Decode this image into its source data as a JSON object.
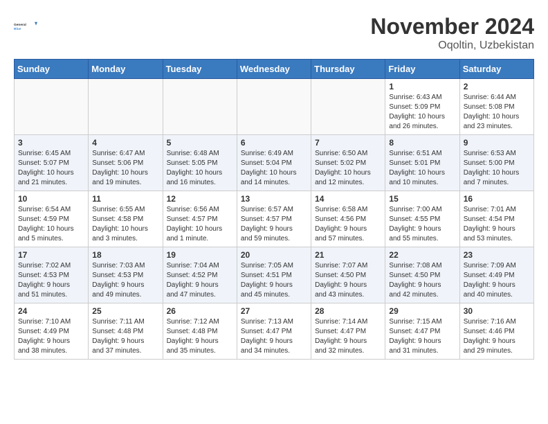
{
  "header": {
    "logo_line1": "General",
    "logo_line2": "Blue",
    "month": "November 2024",
    "location": "Oqoltin, Uzbekistan"
  },
  "weekdays": [
    "Sunday",
    "Monday",
    "Tuesday",
    "Wednesday",
    "Thursday",
    "Friday",
    "Saturday"
  ],
  "weeks": [
    [
      {
        "day": "",
        "info": ""
      },
      {
        "day": "",
        "info": ""
      },
      {
        "day": "",
        "info": ""
      },
      {
        "day": "",
        "info": ""
      },
      {
        "day": "",
        "info": ""
      },
      {
        "day": "1",
        "info": "Sunrise: 6:43 AM\nSunset: 5:09 PM\nDaylight: 10 hours\nand 26 minutes."
      },
      {
        "day": "2",
        "info": "Sunrise: 6:44 AM\nSunset: 5:08 PM\nDaylight: 10 hours\nand 23 minutes."
      }
    ],
    [
      {
        "day": "3",
        "info": "Sunrise: 6:45 AM\nSunset: 5:07 PM\nDaylight: 10 hours\nand 21 minutes."
      },
      {
        "day": "4",
        "info": "Sunrise: 6:47 AM\nSunset: 5:06 PM\nDaylight: 10 hours\nand 19 minutes."
      },
      {
        "day": "5",
        "info": "Sunrise: 6:48 AM\nSunset: 5:05 PM\nDaylight: 10 hours\nand 16 minutes."
      },
      {
        "day": "6",
        "info": "Sunrise: 6:49 AM\nSunset: 5:04 PM\nDaylight: 10 hours\nand 14 minutes."
      },
      {
        "day": "7",
        "info": "Sunrise: 6:50 AM\nSunset: 5:02 PM\nDaylight: 10 hours\nand 12 minutes."
      },
      {
        "day": "8",
        "info": "Sunrise: 6:51 AM\nSunset: 5:01 PM\nDaylight: 10 hours\nand 10 minutes."
      },
      {
        "day": "9",
        "info": "Sunrise: 6:53 AM\nSunset: 5:00 PM\nDaylight: 10 hours\nand 7 minutes."
      }
    ],
    [
      {
        "day": "10",
        "info": "Sunrise: 6:54 AM\nSunset: 4:59 PM\nDaylight: 10 hours\nand 5 minutes."
      },
      {
        "day": "11",
        "info": "Sunrise: 6:55 AM\nSunset: 4:58 PM\nDaylight: 10 hours\nand 3 minutes."
      },
      {
        "day": "12",
        "info": "Sunrise: 6:56 AM\nSunset: 4:57 PM\nDaylight: 10 hours\nand 1 minute."
      },
      {
        "day": "13",
        "info": "Sunrise: 6:57 AM\nSunset: 4:57 PM\nDaylight: 9 hours\nand 59 minutes."
      },
      {
        "day": "14",
        "info": "Sunrise: 6:58 AM\nSunset: 4:56 PM\nDaylight: 9 hours\nand 57 minutes."
      },
      {
        "day": "15",
        "info": "Sunrise: 7:00 AM\nSunset: 4:55 PM\nDaylight: 9 hours\nand 55 minutes."
      },
      {
        "day": "16",
        "info": "Sunrise: 7:01 AM\nSunset: 4:54 PM\nDaylight: 9 hours\nand 53 minutes."
      }
    ],
    [
      {
        "day": "17",
        "info": "Sunrise: 7:02 AM\nSunset: 4:53 PM\nDaylight: 9 hours\nand 51 minutes."
      },
      {
        "day": "18",
        "info": "Sunrise: 7:03 AM\nSunset: 4:53 PM\nDaylight: 9 hours\nand 49 minutes."
      },
      {
        "day": "19",
        "info": "Sunrise: 7:04 AM\nSunset: 4:52 PM\nDaylight: 9 hours\nand 47 minutes."
      },
      {
        "day": "20",
        "info": "Sunrise: 7:05 AM\nSunset: 4:51 PM\nDaylight: 9 hours\nand 45 minutes."
      },
      {
        "day": "21",
        "info": "Sunrise: 7:07 AM\nSunset: 4:50 PM\nDaylight: 9 hours\nand 43 minutes."
      },
      {
        "day": "22",
        "info": "Sunrise: 7:08 AM\nSunset: 4:50 PM\nDaylight: 9 hours\nand 42 minutes."
      },
      {
        "day": "23",
        "info": "Sunrise: 7:09 AM\nSunset: 4:49 PM\nDaylight: 9 hours\nand 40 minutes."
      }
    ],
    [
      {
        "day": "24",
        "info": "Sunrise: 7:10 AM\nSunset: 4:49 PM\nDaylight: 9 hours\nand 38 minutes."
      },
      {
        "day": "25",
        "info": "Sunrise: 7:11 AM\nSunset: 4:48 PM\nDaylight: 9 hours\nand 37 minutes."
      },
      {
        "day": "26",
        "info": "Sunrise: 7:12 AM\nSunset: 4:48 PM\nDaylight: 9 hours\nand 35 minutes."
      },
      {
        "day": "27",
        "info": "Sunrise: 7:13 AM\nSunset: 4:47 PM\nDaylight: 9 hours\nand 34 minutes."
      },
      {
        "day": "28",
        "info": "Sunrise: 7:14 AM\nSunset: 4:47 PM\nDaylight: 9 hours\nand 32 minutes."
      },
      {
        "day": "29",
        "info": "Sunrise: 7:15 AM\nSunset: 4:47 PM\nDaylight: 9 hours\nand 31 minutes."
      },
      {
        "day": "30",
        "info": "Sunrise: 7:16 AM\nSunset: 4:46 PM\nDaylight: 9 hours\nand 29 minutes."
      }
    ]
  ]
}
